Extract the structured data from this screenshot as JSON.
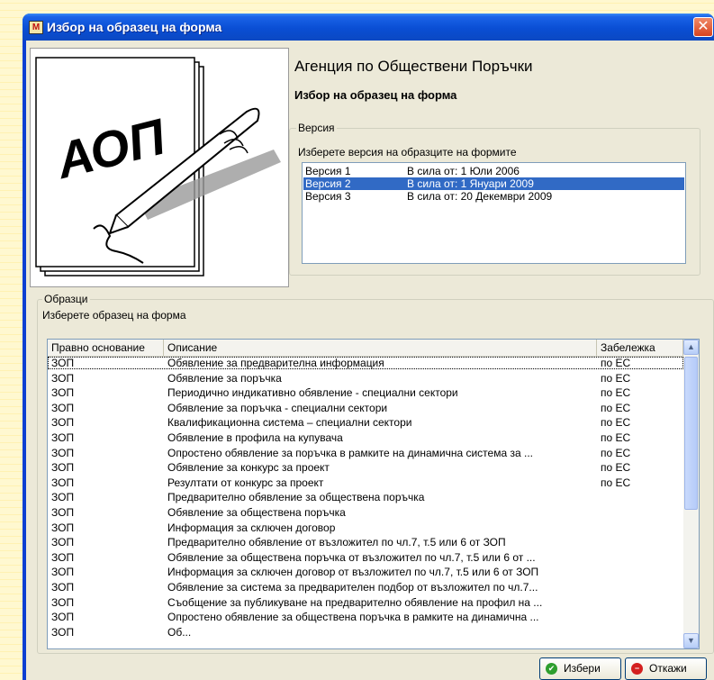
{
  "window": {
    "title": "Избор на образец на форма",
    "icon_letter": "M"
  },
  "header": {
    "org_title": "Агенция по Обществени Поръчки",
    "form_title": "Избор на образец на форма",
    "logo_text": "АОП"
  },
  "version_group": {
    "legend": "Версия",
    "hint": "Изберете версия на образците на формите",
    "items": [
      {
        "name": "Версия 1",
        "date": "В сила от: 1 Юли 2006",
        "selected": false
      },
      {
        "name": "Версия 2",
        "date": "В сила от: 1 Януари 2009",
        "selected": true
      },
      {
        "name": "Версия 3",
        "date": "В сила от: 20 Декември 2009",
        "selected": false
      }
    ]
  },
  "samples_group": {
    "legend": "Образци",
    "hint": "Изберете образец на форма",
    "columns": [
      "Правно основание",
      "Описание",
      "Забележка"
    ],
    "rows": [
      [
        "ЗОП",
        "Обявление за предварителна информация",
        "по ЕС"
      ],
      [
        "ЗОП",
        "Обявление за поръчка",
        "по ЕС"
      ],
      [
        "ЗОП",
        "Периодично индикативно обявление - специални сектори",
        "по ЕС"
      ],
      [
        "ЗОП",
        "Обявление за поръчка - специални сектори",
        "по ЕС"
      ],
      [
        "ЗОП",
        "Квалификационна система – специални сектори",
        "по ЕС"
      ],
      [
        "ЗОП",
        "Обявление в профила на купувача",
        "по ЕС"
      ],
      [
        "ЗОП",
        "Опростено обявление за поръчка в рамките на динамична система за ...",
        "по ЕС"
      ],
      [
        "ЗОП",
        "Обявление за конкурс за проект",
        "по ЕС"
      ],
      [
        "ЗОП",
        "Резултати от конкурс за проект",
        "по ЕС"
      ],
      [
        "ЗОП",
        "Предварително обявление за обществена поръчка",
        ""
      ],
      [
        "ЗОП",
        "Обявление за обществена поръчка",
        ""
      ],
      [
        "ЗОП",
        "Информация за сключен договор",
        ""
      ],
      [
        "ЗОП",
        "Предварително обявление от възложител по чл.7, т.5 или 6 от ЗОП",
        ""
      ],
      [
        "ЗОП",
        "Обявление за обществена поръчка от възложител по чл.7, т.5 или 6 от ...",
        ""
      ],
      [
        "ЗОП",
        "Информация за сключен договор от възложител по чл.7, т.5 или 6 от ЗОП",
        ""
      ],
      [
        "ЗОП",
        "Обявление за система за предварителен подбор от възложител по чл.7...",
        ""
      ],
      [
        "ЗОП",
        "Съобщение за публикуване на предварително обявление на профил на ...",
        ""
      ],
      [
        "ЗОП",
        "Опростено обявление за обществена поръчка в рамките на динамична ...",
        ""
      ],
      [
        "ЗОП",
        "Об...",
        ""
      ]
    ]
  },
  "buttons": {
    "select": "Избери",
    "cancel": "Откажи"
  },
  "colors": {
    "selection": "#316ac5",
    "titlebar": "#0a4ed4",
    "ok_icon": "#2e9e2e",
    "cancel_icon": "#d42020"
  }
}
